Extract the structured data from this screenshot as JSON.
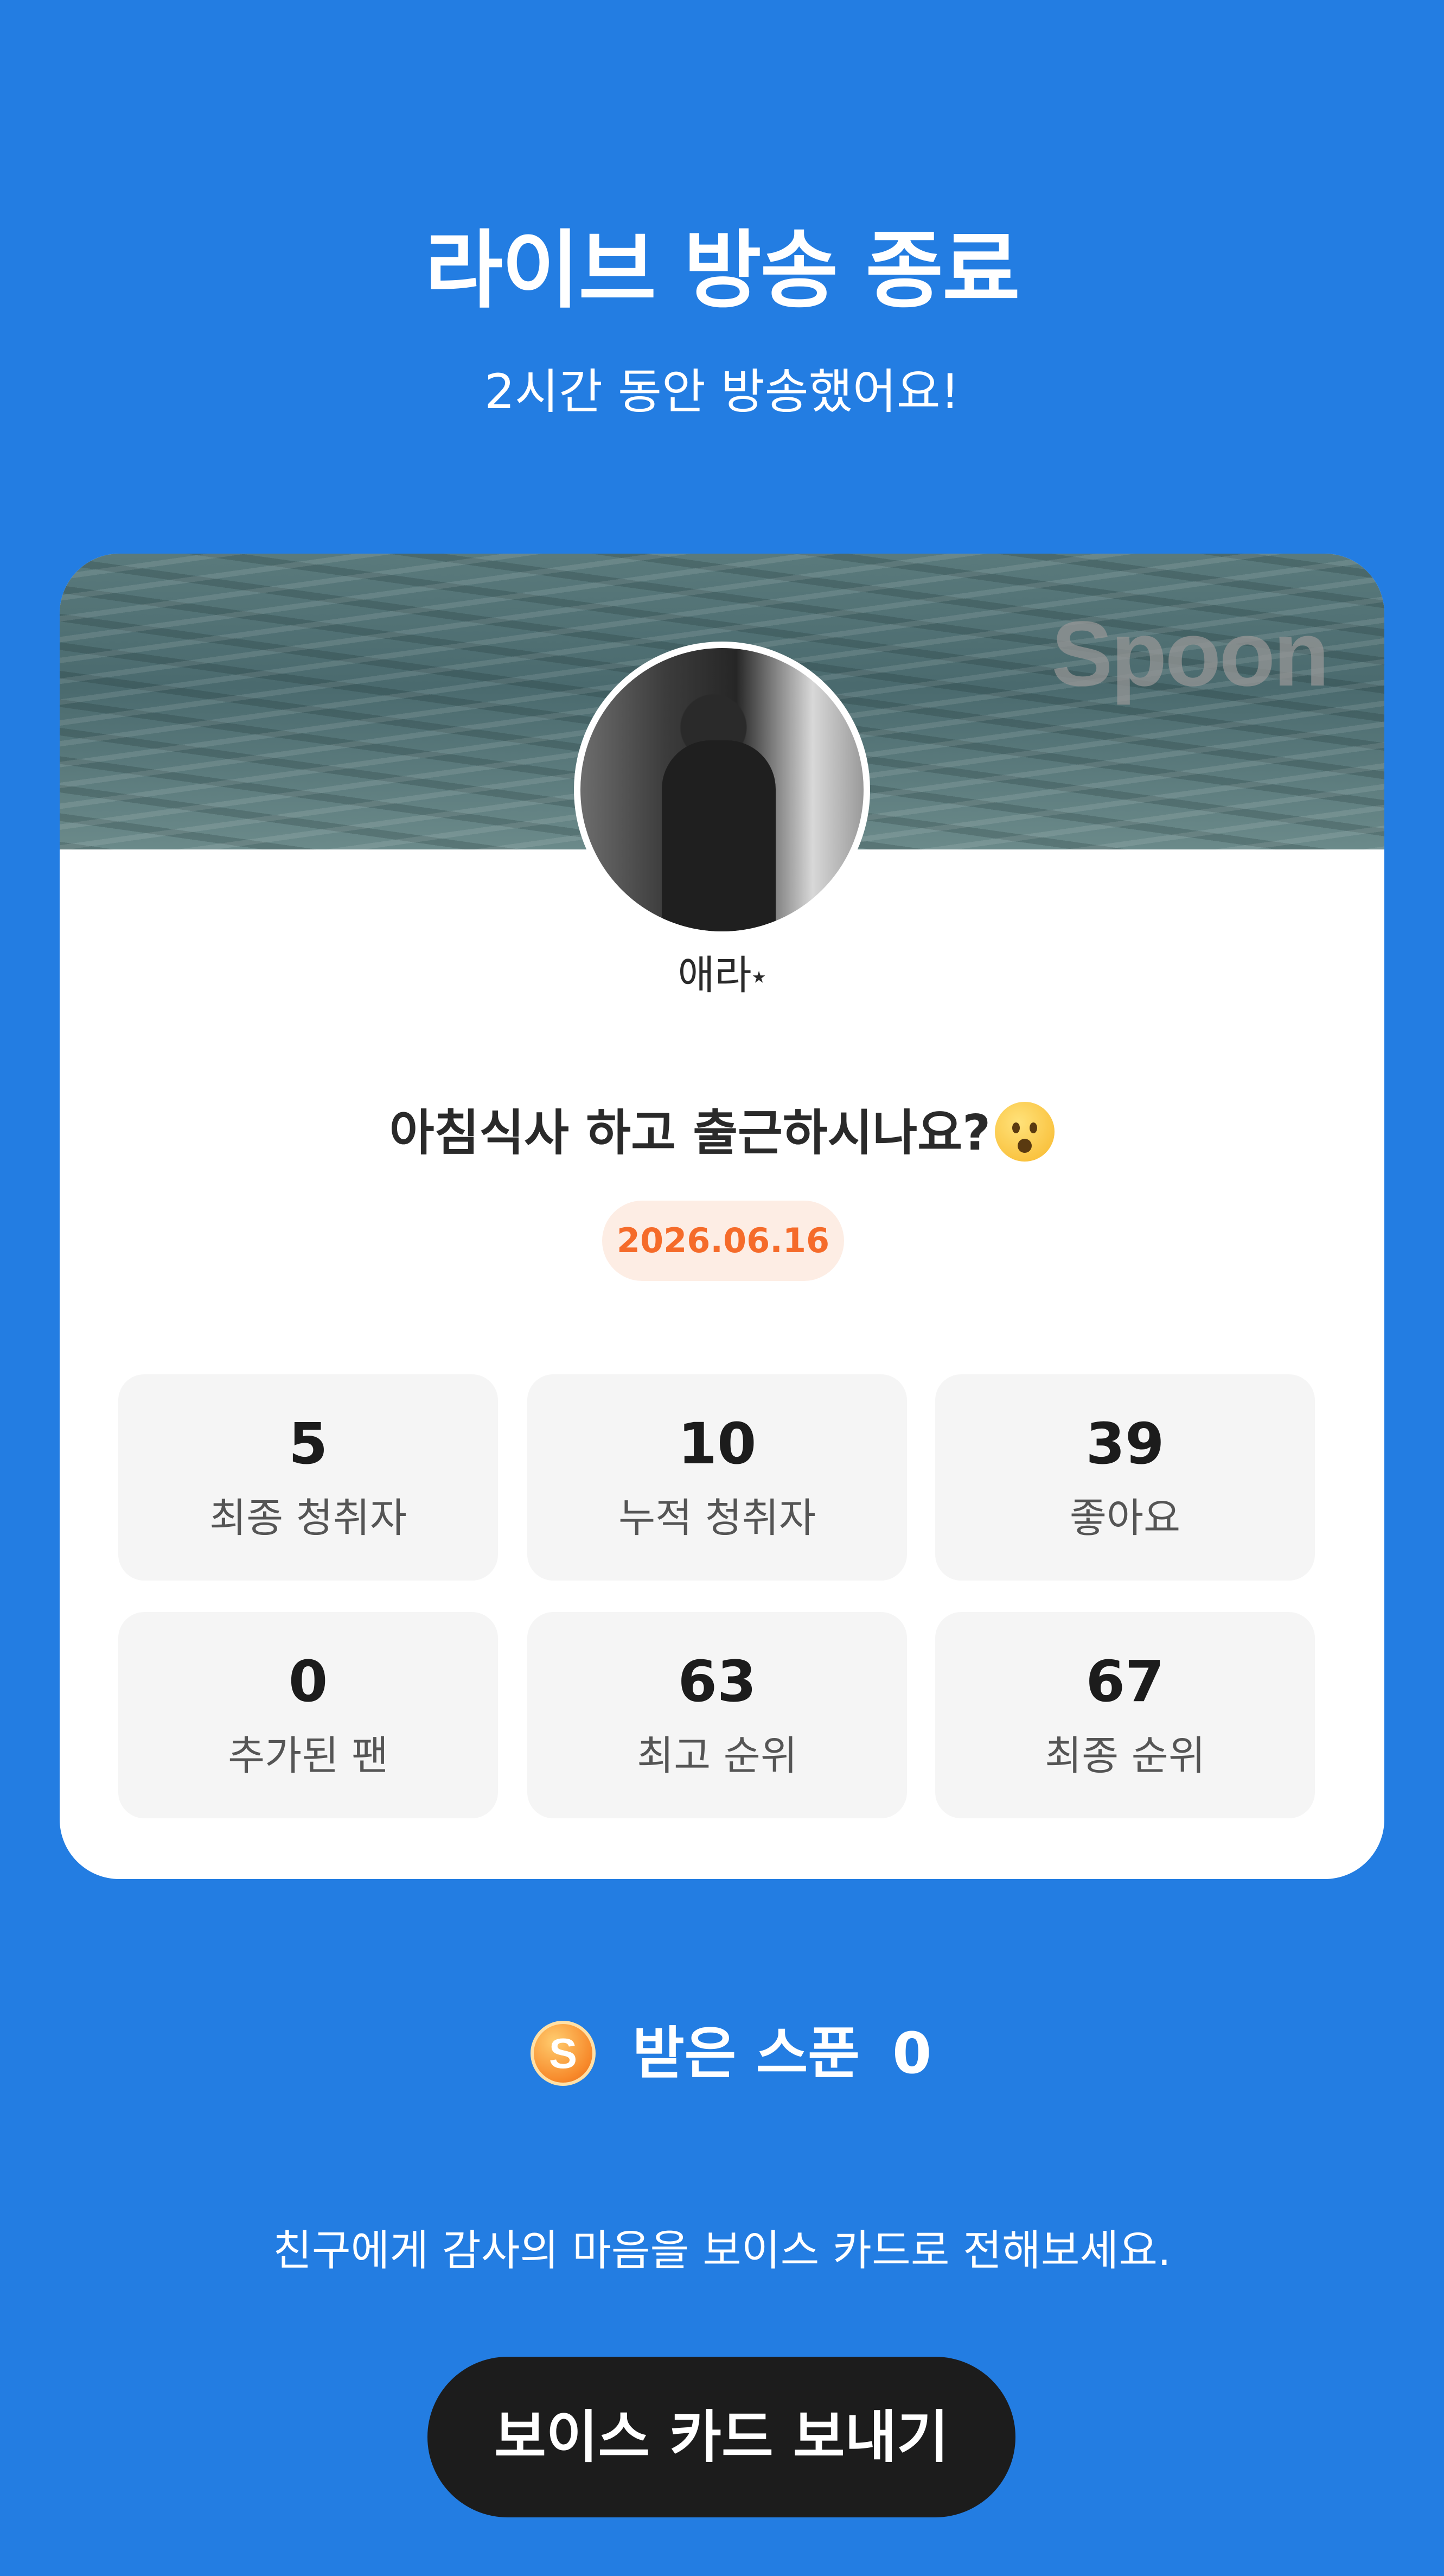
{
  "header": {
    "title": "라이브 방송 종료",
    "subtitle": "2시간 동안 방송했어요!"
  },
  "card": {
    "cover_logo": "Spoon",
    "nickname": "애라",
    "nickname_star": "★",
    "live_title": "아침식사 하고 출근하시나요?",
    "title_emoji": "hushed-face-emoji",
    "date": "2026.06.16",
    "stats": [
      {
        "value": "5",
        "label": "최종 청취자"
      },
      {
        "value": "10",
        "label": "누적 청취자"
      },
      {
        "value": "39",
        "label": "좋아요"
      },
      {
        "value": "0",
        "label": "추가된 팬"
      },
      {
        "value": "63",
        "label": "최고 순위"
      },
      {
        "value": "67",
        "label": "최종 순위"
      }
    ]
  },
  "spoon": {
    "coin_symbol": "S",
    "label": "받은 스푼",
    "count": "0"
  },
  "footer": {
    "thanks_text": "친구에게 감사의 마음을 보이스 카드로 전해보세요.",
    "voice_card_button": "보이스 카드 보내기"
  },
  "colors": {
    "background": "#237de2",
    "date_badge_text": "#f56b2a",
    "date_badge_bg": "#fdede4",
    "button_bg": "#1c1c1c"
  }
}
